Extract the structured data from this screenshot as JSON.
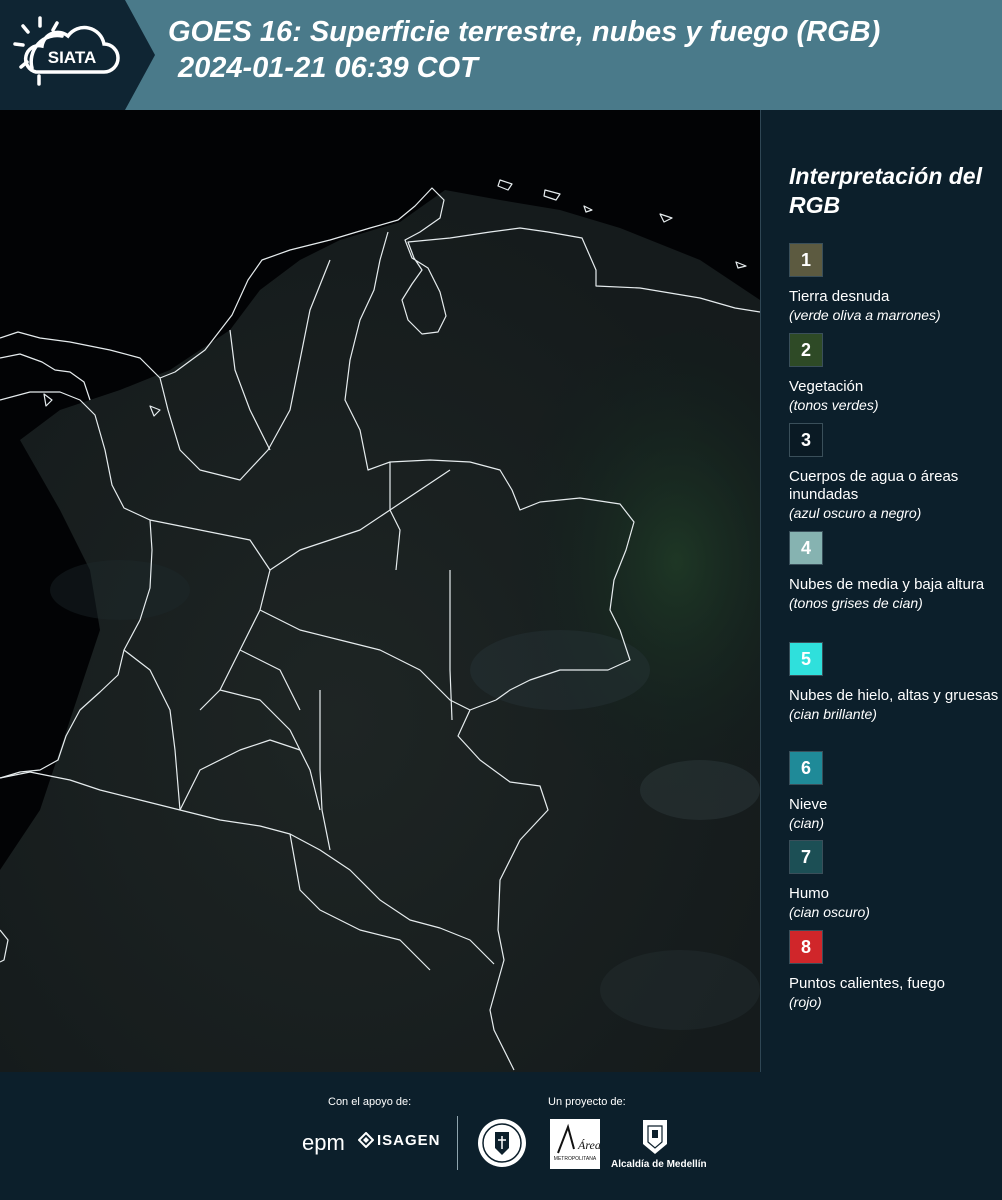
{
  "header": {
    "logo_text": "SIATA",
    "title_line1": "GOES 16: Superficie terrestre, nubes y fuego (RGB)",
    "title_line2": "2024-01-21 06:39 COT"
  },
  "legend": {
    "title": "Interpretación del RGB",
    "items": [
      {
        "number": "1",
        "label": "Tierra desnuda",
        "desc": "(verde oliva a marrones)",
        "color": "#5c5a40"
      },
      {
        "number": "2",
        "label": "Vegetación",
        "desc": "(tonos verdes)",
        "color": "#2e4a26"
      },
      {
        "number": "3",
        "label": "Cuerpos de agua o áreas inundadas",
        "desc": "(azul oscuro a negro)",
        "color": "#0a1a24"
      },
      {
        "number": "4",
        "label": "Nubes de media y baja altura",
        "desc": "(tonos grises de cian)",
        "color": "#86b3b1"
      },
      {
        "number": "5",
        "label": "Nubes de hielo, altas y gruesas",
        "desc": "(cian brillante)",
        "color": "#2fe0dc"
      },
      {
        "number": "6",
        "label": "Nieve",
        "desc": "(cian)",
        "color": "#1f8a98"
      },
      {
        "number": "7",
        "label": "Humo",
        "desc": "(cian oscuro)",
        "color": "#1c4f55"
      },
      {
        "number": "8",
        "label": "Puntos calientes, fuego",
        "desc": "(rojo)",
        "color": "#d0262a"
      }
    ]
  },
  "footer": {
    "support_label": "Con el apoyo de:",
    "project_label": "Un proyecto de:",
    "epm_text": "epm",
    "isagen_text": "ISAGEN",
    "area_text": "Área",
    "area_sub": "METROPOLITANA",
    "alcaldia_text": "Alcaldía de Medellín"
  }
}
